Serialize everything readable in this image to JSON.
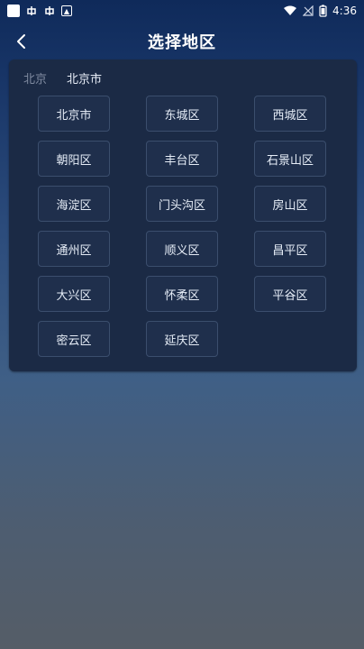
{
  "status_bar": {
    "time": "4:36",
    "left_icons": [
      "app-square-icon",
      "bug-icon",
      "bug-icon",
      "photo-icon"
    ],
    "right_icons": [
      "wifi-icon",
      "no-signal-icon",
      "battery-icon"
    ]
  },
  "header": {
    "title": "选择地区",
    "back_icon": "chevron-left-icon"
  },
  "breadcrumbs": [
    {
      "label": "北京",
      "active": false
    },
    {
      "label": "北京市",
      "active": true
    }
  ],
  "districts": [
    "北京市",
    "东城区",
    "西城区",
    "朝阳区",
    "丰台区",
    "石景山区",
    "海淀区",
    "门头沟区",
    "房山区",
    "通州区",
    "顺义区",
    "昌平区",
    "大兴区",
    "怀柔区",
    "平谷区",
    "密云区",
    "延庆区"
  ],
  "colors": {
    "panel_bg": "#1b2a45",
    "button_border": "#3b4e6d",
    "text": "#e6edf7",
    "muted": "#7f8aa0"
  }
}
